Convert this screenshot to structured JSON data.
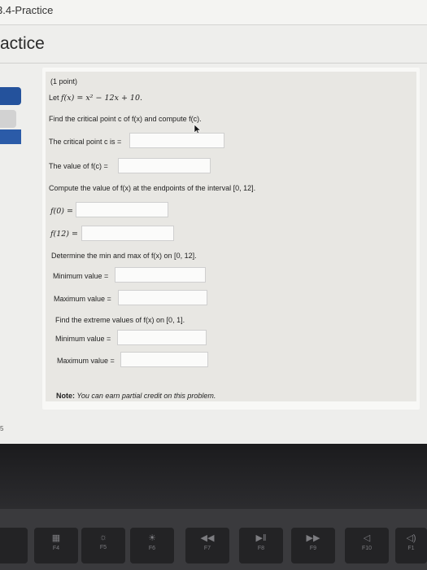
{
  "header": {
    "title": "3.4-Practice"
  },
  "section": {
    "title": "actice"
  },
  "problem": {
    "points": "(1 point)",
    "let_label": "Let",
    "function_def": "f(x) = x² − 12x + 10.",
    "instruction": "Find the critical point c of f(x) and compute f(c).",
    "critical_label": "The critical point c is =",
    "value_label": "The value of f(c) =",
    "endpoints_instruction": "Compute the value of f(x) at the endpoints of the interval [0, 12].",
    "f0_label": "f(0) =",
    "f12_label": "f(12) =",
    "minmax_instruction": "Determine the min and max of f(x) on [0, 12].",
    "min_label": "Minimum value =",
    "max_label": "Maximum value =",
    "extreme_instruction": "Find the extreme values of f(x) on [0, 1].",
    "min2_label": "Minimum value =",
    "max2_label": "Maximum value =",
    "note_bold": "Note:",
    "note_text": " You can earn partial credit on this problem."
  },
  "footer": {
    "tab_text": "5"
  },
  "keyboard": {
    "keys": [
      {
        "icon": "▦",
        "label": "F4"
      },
      {
        "icon": "☼",
        "label": "F5"
      },
      {
        "icon": "☀",
        "label": "F6"
      },
      {
        "icon": "◀◀",
        "label": "F7"
      },
      {
        "icon": "▶‖",
        "label": "F8"
      },
      {
        "icon": "▶▶",
        "label": "F9"
      },
      {
        "icon": "◁",
        "label": "F10"
      },
      {
        "icon": "◁)",
        "label": "F1"
      }
    ]
  }
}
